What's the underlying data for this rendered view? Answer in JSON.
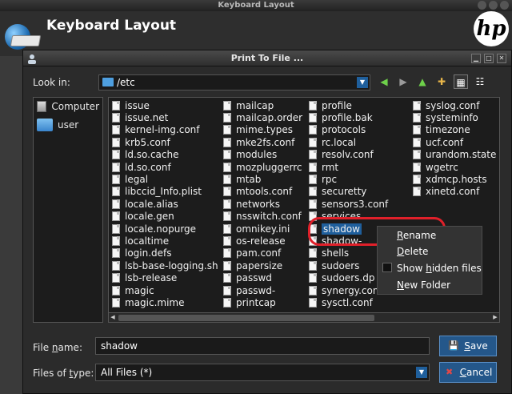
{
  "app": {
    "window_title": "Keyboard Layout",
    "header_title": "Keyboard Layout",
    "logo_text": "hp"
  },
  "dialog": {
    "title": "Print To File ...",
    "look_in_label": "Look in:",
    "look_in_value": "/etc",
    "places": [
      {
        "label": "Computer",
        "icon": "computer-icon"
      },
      {
        "label": "user",
        "icon": "folder-icon"
      }
    ],
    "files": {
      "columns": [
        [
          "issue",
          "issue.net",
          "kernel-img.conf",
          "krb5.conf",
          "ld.so.cache",
          "ld.so.conf",
          "legal",
          "libccid_Info.plist",
          "locale.alias",
          "locale.gen",
          "locale.nopurge",
          "localtime",
          "login.defs",
          "lsb-base-logging.sh",
          "lsb-release",
          "magic",
          "magic.mime"
        ],
        [
          "mailcap",
          "mailcap.order",
          "mime.types",
          "mke2fs.conf",
          "modules",
          "mozpluggerrc",
          "mtab",
          "mtools.conf",
          "networks",
          "nsswitch.conf",
          "omnikey.ini",
          "os-release",
          "pam.conf",
          "papersize",
          "passwd",
          "passwd-",
          "printcap"
        ],
        [
          "profile",
          "profile.bak",
          "protocols",
          "rc.local",
          "resolv.conf",
          "rmt",
          "rpc",
          "securetty",
          "sensors3.conf",
          "services",
          "shadow",
          "shadow-",
          "shells",
          "sudoers",
          "sudoers.dp",
          "synergy.con",
          "sysctl.conf"
        ],
        [
          "syslog.conf",
          "systeminfo",
          "timezone",
          "ucf.conf",
          "urandom.state",
          "wgetrc",
          "xdmcp.hosts",
          "xinetd.conf"
        ]
      ],
      "selected": "shadow"
    },
    "context_menu": {
      "rename_pre": "",
      "rename_u": "R",
      "rename_post": "ename",
      "delete_pre": "",
      "delete_u": "D",
      "delete_post": "elete",
      "hidden_pre": "Show ",
      "hidden_u": "h",
      "hidden_post": "idden files",
      "newfolder_pre": "",
      "newfolder_u": "N",
      "newfolder_post": "ew Folder"
    },
    "file_name_label_pre": "File ",
    "file_name_label_u": "n",
    "file_name_label_post": "ame:",
    "file_name_value": "shadow",
    "files_of_type_label_pre": "Files of ",
    "files_of_type_label_u": "t",
    "files_of_type_label_post": "ype:",
    "files_of_type_value": "All Files (*)",
    "save_pre": "",
    "save_u": "S",
    "save_post": "ave",
    "cancel_pre": "",
    "cancel_u": "C",
    "cancel_post": "ancel"
  },
  "colors": {
    "accent": "#1f5f9c",
    "highlight_ring": "#e0202a"
  }
}
